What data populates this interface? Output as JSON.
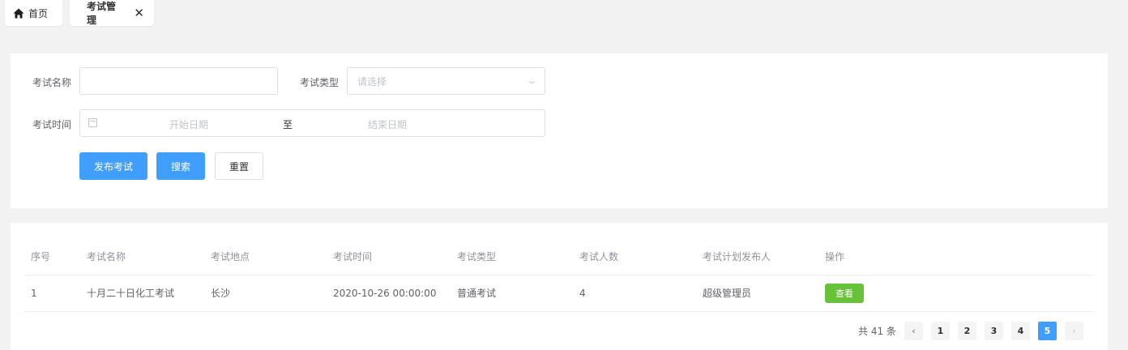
{
  "tabs": [
    {
      "label": "首页",
      "icon": "home-icon"
    },
    {
      "label": "考试管理",
      "close_icon": "close-icon"
    }
  ],
  "close_glyph": "✕",
  "search": {
    "name_label": "考试名称",
    "name_value": "",
    "type_label": "考试类型",
    "type_placeholder": "请选择",
    "time_label": "考试时间",
    "start_placeholder": "开始日期",
    "range_separator": "至",
    "end_placeholder": "结束日期",
    "publish_button": "发布考试",
    "search_button": "搜索",
    "reset_button": "重置"
  },
  "table": {
    "headers": [
      "序号",
      "考试名称",
      "考试地点",
      "考试时间",
      "考试类型",
      "考试人数",
      "考试计划发布人",
      "操作"
    ],
    "rows": [
      {
        "index": "1",
        "name": "十月二十日化工考试",
        "location": "长沙",
        "time": "2020-10-26 00:00:00",
        "type": "普通考试",
        "count": "4",
        "publisher": "超级管理员",
        "action": "查看"
      }
    ]
  },
  "pagination": {
    "total_text": "共 41 条",
    "prev": "‹",
    "next": "›",
    "pages": [
      "1",
      "2",
      "3",
      "4",
      "5"
    ],
    "current_page": "5"
  },
  "colors": {
    "primary": "#409eff",
    "success": "#67c23a",
    "background": "#f2f2f2"
  }
}
